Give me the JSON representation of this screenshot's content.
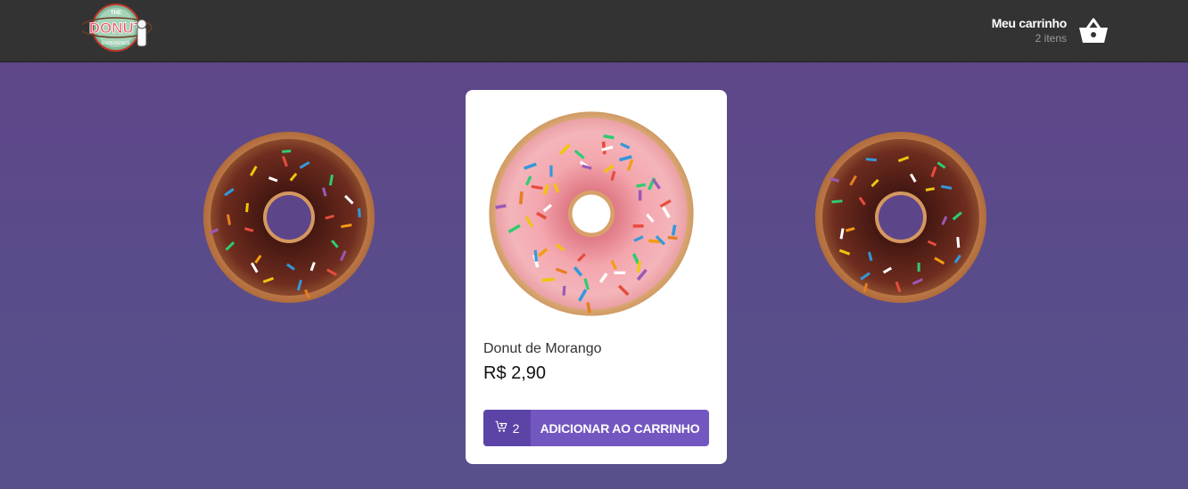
{
  "header": {
    "logo": {
      "small_top": "THE",
      "main": "DONUT",
      "small_bottom": "EXPERIENCE"
    },
    "cart": {
      "title": "Meu carrinho",
      "count": "2 itens",
      "icon": "basket-icon"
    }
  },
  "product": {
    "name": "Donut de Morango",
    "price": "R$ 2,90",
    "quantity": "2",
    "add_label": "ADICIONAR AO CARRINHO",
    "cart_icon": "cart-add-icon"
  },
  "colors": {
    "header_bg": "#333333",
    "accent": "#7357c1",
    "accent_dark": "#5c43a6",
    "background_top": "#5f4589",
    "background_bottom": "#56518b"
  }
}
